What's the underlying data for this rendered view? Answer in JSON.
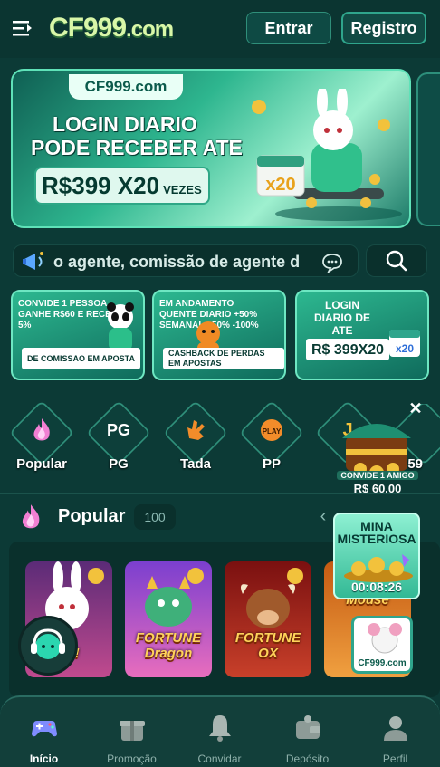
{
  "header": {
    "logo": "CF999",
    "logo_suffix": ".com",
    "login_label": "Entrar",
    "register_label": "Registro"
  },
  "banner": {
    "logo": "CF999.com",
    "line1": "LOGIN DIARIO",
    "line2": "PODE RECEBER ATE",
    "amount": "R$399 X20",
    "amount_suffix": "VEZES",
    "badge": "x20"
  },
  "marquee": {
    "text": "o agente, comissão de agente d"
  },
  "promos": [
    {
      "text": "CONVIDE 1 PESSOA GANHE R$60 E RECEBA 5%",
      "strip": "DE COMISSAO EM APOSTA"
    },
    {
      "text": "EM ANDAMENTO QUENTE DIARIO +50% SEMANAL +50% -100%",
      "strip": "CASHBACK DE PERDAS EM APOSTAS"
    },
    {
      "text": "LOGIN DIARIO DE ATE",
      "strip": "R$ 399X20",
      "badge": "x20"
    }
  ],
  "categories": [
    {
      "label": "Popular",
      "icon": "fire-icon"
    },
    {
      "label": "PG",
      "icon": "pg-logo-icon"
    },
    {
      "label": "Tada",
      "icon": "tada-hand-icon"
    },
    {
      "label": "PP",
      "icon": "pp-play-icon"
    },
    {
      "label": "JI",
      "icon": "jili-icon"
    },
    {
      "label": "759",
      "icon": "daxo-icon"
    }
  ],
  "popular": {
    "title": "Popular",
    "count": "100",
    "prev": "‹"
  },
  "games": [
    {
      "name": "Fortune Rabbit",
      "title": "bit!",
      "color": "#c04a8e"
    },
    {
      "name": "Fortune Dragon",
      "title": "FORTUNE Dragon",
      "color": "#a047c9"
    },
    {
      "name": "Fortune Ox",
      "title": "FORTUNE OX",
      "color": "#b0241f"
    },
    {
      "name": "Fortune Mouse",
      "title": "Mouse",
      "color": "#e0862a"
    }
  ],
  "float_invite": {
    "label": "CONVIDE 1 AMIGO",
    "amount": "R$ 60.00"
  },
  "mina": {
    "title": "MINA MISTERIOSA",
    "timer": "00:08:26",
    "logo": "CF999.com"
  },
  "tabbar": [
    {
      "label": "Início",
      "icon": "gamepad-icon",
      "active": true
    },
    {
      "label": "Promoção",
      "icon": "gift-icon",
      "active": false
    },
    {
      "label": "Convidar",
      "icon": "bell-icon",
      "active": false
    },
    {
      "label": "Depósito",
      "icon": "wallet-icon",
      "active": false
    },
    {
      "label": "Perfil",
      "icon": "user-icon",
      "active": false
    }
  ],
  "colors": {
    "background": "#0c3a36",
    "accent": "#2fa58c",
    "banner_green": "#2eb68f"
  }
}
